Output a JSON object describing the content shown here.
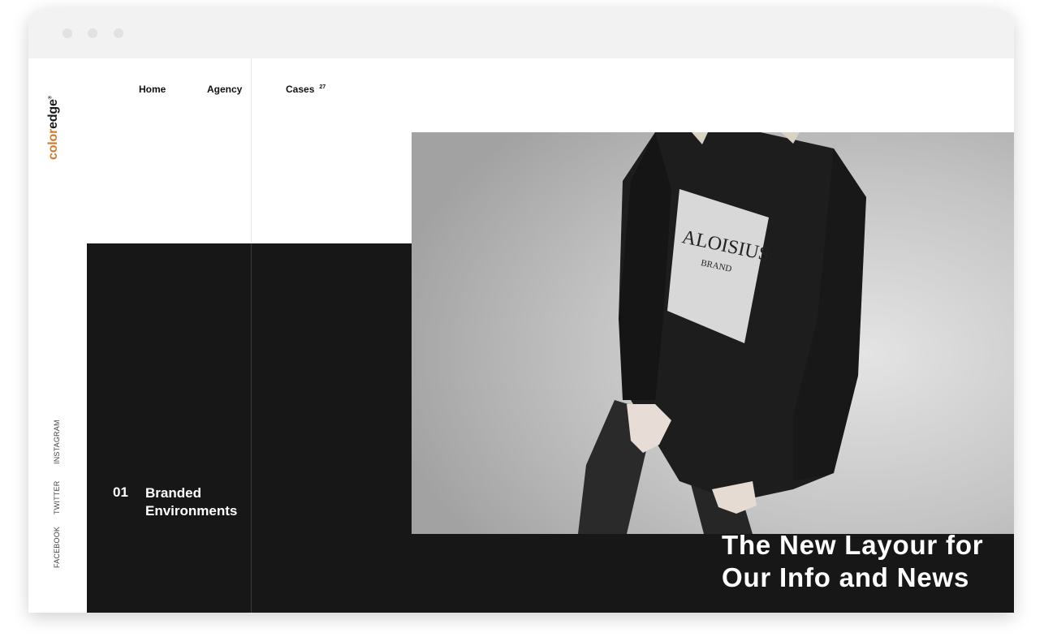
{
  "brand": {
    "part1": "color",
    "part2": "edge",
    "mark": "®",
    "accent": "#d27a2b"
  },
  "nav": {
    "home": "Home",
    "agency": "Agency",
    "cases": "Cases",
    "cases_count": "27"
  },
  "social": {
    "instagram": "INSTAGRAM",
    "twitter": "TWITTER",
    "facebook": "FACEBOOK"
  },
  "feature": {
    "number": "01",
    "label": "Branded Environments"
  },
  "hero": {
    "shirt_text_1": "ALOISIUS",
    "shirt_text_2": "BRAND",
    "headline": "The New Layour for Our Info and News"
  },
  "colors": {
    "dark_panel": "#171717",
    "text_on_dark": "#ffffff"
  }
}
